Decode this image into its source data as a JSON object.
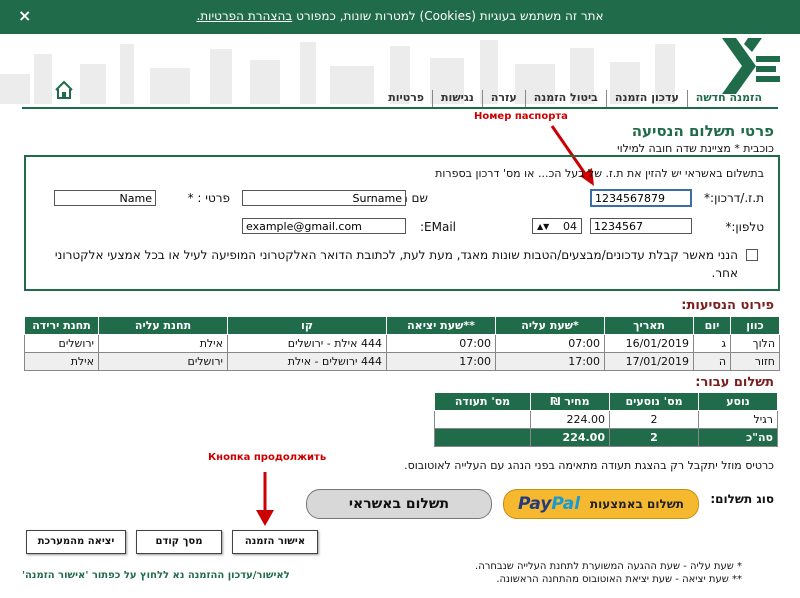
{
  "cookie_banner": {
    "message": "אתר זה משתמש בעוגיות (Cookies) למטרות שונות, כמפורט",
    "link_text": "בהצהרת הפרטיות.",
    "close": "×"
  },
  "icons": {
    "close": "close-icon",
    "home": "home-icon",
    "logo": "egged-logo-icon",
    "arrow": "arrow-down-icon",
    "dropdown": "spinner-arrows-icon"
  },
  "nav": {
    "tabs": [
      "הזמנה חדשה",
      "עדכון הזמנה",
      "ביטול הזמנה",
      "עזרה",
      "נגישות",
      "פרטיות"
    ],
    "active": 0
  },
  "page": {
    "title": "פרטי תשלום הנסיעה",
    "required_note": "כוכבית * מציינת שדה חובה למילוי",
    "required_star": "*"
  },
  "annotations": {
    "passport": "Номер паспорта",
    "continue": "Кнопка продолжить"
  },
  "form": {
    "instruction": "בתשלום באשראי יש להזין את ת.ז. של בעל הכ... או מס' דרכון בספרות",
    "id_label": "ת.ז./דרכון:*",
    "id_value": "1234567879",
    "surname_label": "שם משפחה :*",
    "surname_value": "Surname",
    "firstname_label": "פרטי : *",
    "firstname_value": "Name",
    "phone_label": "טלפון:*",
    "phone_value": "1234567",
    "phone_prefix": "04",
    "email_label": "EMail:",
    "email_value": "example@gmail.com",
    "consent_text": "הנני מאשר קבלת עדכונים/מבצעים/הטבות שונות מאגד, מעת לעת, לכתובת הדואר האלקטרוני המופיעה לעיל או בכל אמצעי אלקטרוני אחר."
  },
  "trips": {
    "title": "פירוט הנסיעות:",
    "headers": [
      "כוון",
      "יום",
      "תאריך",
      "*שעת עליה",
      "**שעת יציאה",
      "קו",
      "תחנת עליה",
      "תחנת ירידה"
    ],
    "rows": [
      [
        "הלוך",
        "ג",
        "16/01/2019",
        "07:00",
        "07:00",
        "444 אילת - ירושלים",
        "אילת",
        "ירושלים"
      ],
      [
        "חזור",
        "ה",
        "17/01/2019",
        "17:00",
        "17:00",
        "444 ירושלים - אילת",
        "ירושלים",
        "אילת"
      ]
    ]
  },
  "payment": {
    "title": "תשלום עבור:",
    "headers": [
      "נוסע",
      "מס' נוסעים",
      "מחיר ₪",
      "מס' תעודה"
    ],
    "rows": [
      [
        "רגיל",
        "2",
        "224.00",
        ""
      ],
      [
        "סה\"כ",
        "2",
        "224.00",
        ""
      ]
    ]
  },
  "student_note": "כרטיס מוזל יתקבל רק בהצגת תעודה מתאימה בפני הנהג עם העלייה לאוטובוס.",
  "payment_type": {
    "label": "סוג תשלום:",
    "paypal_label": "תשלום באמצעות",
    "paypal_brand_1": "Pay",
    "paypal_brand_2": "Pal",
    "card_label": "תשלום באשראי"
  },
  "buttons": {
    "confirm": "אישור הזמנה",
    "previous": "מסך קודם",
    "exit": "יציאה מהמערכת"
  },
  "footnotes": {
    "line1": "* שעת עליה - שעת ההגעה המשוערת לתחנת העלייה שנבחרה.",
    "line2": "** שעת יציאה - שעת יציאת האוטובוס מהתחנה הראשונה."
  },
  "footer_note": "לאישור/עדכון ההזמנה נא ללחוץ על כפתור 'אישור הזמנה'",
  "colors": {
    "brand_green": "#1f6b4a",
    "annotation_red": "#cc0000",
    "section_title": "#7a1e1e",
    "paypal_yellow": "#f5b82e"
  }
}
